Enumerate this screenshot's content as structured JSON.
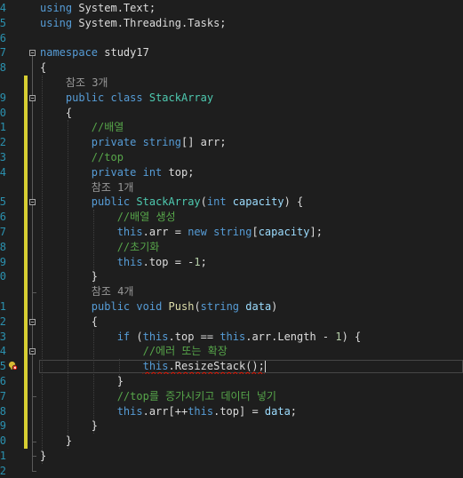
{
  "editor": {
    "language": "C#",
    "colors": {
      "background": "#1e1e1e",
      "line_number": "#2b91af",
      "keyword": "#569cd6",
      "type": "#4ec9b0",
      "comment": "#57a64a",
      "method": "#dcdcaa",
      "parameter": "#9cdcfe",
      "number": "#b5cea8",
      "codelens": "#999999",
      "saved_change": "#d7ce32",
      "error": "#e51400"
    },
    "lines": [
      {
        "num": "4",
        "change": "",
        "tokens": [
          {
            "t": "using",
            "c": "kw"
          },
          {
            "t": " System.Text;",
            "c": "pl"
          }
        ]
      },
      {
        "num": "5",
        "change": "",
        "tokens": [
          {
            "t": "using",
            "c": "kw"
          },
          {
            "t": " System.Threading.Tasks;",
            "c": "pl"
          }
        ]
      },
      {
        "num": "6",
        "change": "",
        "tokens": []
      },
      {
        "num": "7",
        "change": "",
        "tokens": [
          {
            "t": "namespace",
            "c": "kw"
          },
          {
            "t": " study17",
            "c": "pl"
          }
        ]
      },
      {
        "num": "8",
        "change": "",
        "tokens": [
          {
            "t": "{",
            "c": "pl"
          }
        ]
      },
      {
        "num": "",
        "change": "saved",
        "tokens": [
          {
            "t": "    참조 3개",
            "c": "lens"
          }
        ]
      },
      {
        "num": "9",
        "change": "saved",
        "tokens": [
          {
            "t": "    ",
            "c": "pl"
          },
          {
            "t": "public",
            "c": "kw"
          },
          {
            "t": " ",
            "c": "pl"
          },
          {
            "t": "class",
            "c": "kw"
          },
          {
            "t": " ",
            "c": "pl"
          },
          {
            "t": "StackArray",
            "c": "ty"
          }
        ]
      },
      {
        "num": "0",
        "change": "saved",
        "tokens": [
          {
            "t": "    {",
            "c": "pl"
          }
        ]
      },
      {
        "num": "1",
        "change": "saved",
        "tokens": [
          {
            "t": "        ",
            "c": "pl"
          },
          {
            "t": "//배열",
            "c": "cm"
          }
        ]
      },
      {
        "num": "2",
        "change": "saved",
        "tokens": [
          {
            "t": "        ",
            "c": "pl"
          },
          {
            "t": "private",
            "c": "kw"
          },
          {
            "t": " ",
            "c": "pl"
          },
          {
            "t": "string",
            "c": "kw"
          },
          {
            "t": "[] arr;",
            "c": "pl"
          }
        ]
      },
      {
        "num": "3",
        "change": "saved",
        "tokens": [
          {
            "t": "        ",
            "c": "pl"
          },
          {
            "t": "//top",
            "c": "cm"
          }
        ]
      },
      {
        "num": "4",
        "change": "saved",
        "tokens": [
          {
            "t": "        ",
            "c": "pl"
          },
          {
            "t": "private",
            "c": "kw"
          },
          {
            "t": " ",
            "c": "pl"
          },
          {
            "t": "int",
            "c": "kw"
          },
          {
            "t": " top;",
            "c": "pl"
          }
        ]
      },
      {
        "num": "",
        "change": "saved",
        "tokens": [
          {
            "t": "        참조 1개",
            "c": "lens"
          }
        ]
      },
      {
        "num": "5",
        "change": "saved",
        "tokens": [
          {
            "t": "        ",
            "c": "pl"
          },
          {
            "t": "public",
            "c": "kw"
          },
          {
            "t": " ",
            "c": "pl"
          },
          {
            "t": "StackArray",
            "c": "ty"
          },
          {
            "t": "(",
            "c": "pl"
          },
          {
            "t": "int",
            "c": "kw"
          },
          {
            "t": " ",
            "c": "pl"
          },
          {
            "t": "capacity",
            "c": "pm"
          },
          {
            "t": ") {",
            "c": "pl"
          }
        ]
      },
      {
        "num": "6",
        "change": "saved",
        "tokens": [
          {
            "t": "            ",
            "c": "pl"
          },
          {
            "t": "//배열 생성",
            "c": "cm"
          }
        ]
      },
      {
        "num": "7",
        "change": "saved",
        "tokens": [
          {
            "t": "            ",
            "c": "pl"
          },
          {
            "t": "this",
            "c": "kw"
          },
          {
            "t": ".arr = ",
            "c": "pl"
          },
          {
            "t": "new",
            "c": "kw"
          },
          {
            "t": " ",
            "c": "pl"
          },
          {
            "t": "string",
            "c": "kw"
          },
          {
            "t": "[",
            "c": "pl"
          },
          {
            "t": "capacity",
            "c": "pm"
          },
          {
            "t": "];",
            "c": "pl"
          }
        ]
      },
      {
        "num": "8",
        "change": "saved",
        "tokens": [
          {
            "t": "            ",
            "c": "pl"
          },
          {
            "t": "//초기화",
            "c": "cm"
          }
        ]
      },
      {
        "num": "9",
        "change": "saved",
        "tokens": [
          {
            "t": "            ",
            "c": "pl"
          },
          {
            "t": "this",
            "c": "kw"
          },
          {
            "t": ".top = -",
            "c": "pl"
          },
          {
            "t": "1",
            "c": "nm"
          },
          {
            "t": ";",
            "c": "pl"
          }
        ]
      },
      {
        "num": "0",
        "change": "saved",
        "tokens": [
          {
            "t": "        }",
            "c": "pl"
          }
        ]
      },
      {
        "num": "",
        "change": "saved",
        "tokens": [
          {
            "t": "        참조 4개",
            "c": "lens"
          }
        ]
      },
      {
        "num": "1",
        "change": "saved",
        "tokens": [
          {
            "t": "        ",
            "c": "pl"
          },
          {
            "t": "public",
            "c": "kw"
          },
          {
            "t": " ",
            "c": "pl"
          },
          {
            "t": "void",
            "c": "kw"
          },
          {
            "t": " ",
            "c": "pl"
          },
          {
            "t": "Push",
            "c": "fn"
          },
          {
            "t": "(",
            "c": "pl"
          },
          {
            "t": "string",
            "c": "kw"
          },
          {
            "t": " ",
            "c": "pl"
          },
          {
            "t": "data",
            "c": "pm"
          },
          {
            "t": ")",
            "c": "pl"
          }
        ]
      },
      {
        "num": "2",
        "change": "saved",
        "tokens": [
          {
            "t": "        {",
            "c": "pl"
          }
        ]
      },
      {
        "num": "3",
        "change": "saved",
        "tokens": [
          {
            "t": "            ",
            "c": "pl"
          },
          {
            "t": "if",
            "c": "kw"
          },
          {
            "t": " (",
            "c": "pl"
          },
          {
            "t": "this",
            "c": "kw"
          },
          {
            "t": ".top == ",
            "c": "pl"
          },
          {
            "t": "this",
            "c": "kw"
          },
          {
            "t": ".arr.Length - ",
            "c": "pl"
          },
          {
            "t": "1",
            "c": "nm"
          },
          {
            "t": ") {",
            "c": "pl"
          }
        ]
      },
      {
        "num": "4",
        "change": "saved",
        "tokens": [
          {
            "t": "                ",
            "c": "pl"
          },
          {
            "t": "//에러 또는 확장",
            "c": "cm"
          }
        ]
      },
      {
        "num": "5",
        "change": "saved",
        "current": true,
        "error": true,
        "tokens": [
          {
            "t": "                ",
            "c": "pl"
          },
          {
            "t": "this",
            "c": "kw",
            "sq": true
          },
          {
            "t": ".ResizeStack();",
            "c": "pl",
            "sq": true
          }
        ]
      },
      {
        "num": "6",
        "change": "saved",
        "tokens": [
          {
            "t": "            }",
            "c": "pl"
          }
        ]
      },
      {
        "num": "7",
        "change": "saved",
        "tokens": [
          {
            "t": "            ",
            "c": "pl"
          },
          {
            "t": "//top를 증가시키고 데이터 넣기",
            "c": "cm"
          }
        ]
      },
      {
        "num": "8",
        "change": "saved",
        "tokens": [
          {
            "t": "            ",
            "c": "pl"
          },
          {
            "t": "this",
            "c": "kw"
          },
          {
            "t": ".arr[++",
            "c": "pl"
          },
          {
            "t": "this",
            "c": "kw"
          },
          {
            "t": ".top] = ",
            "c": "pl"
          },
          {
            "t": "data",
            "c": "pm"
          },
          {
            "t": ";",
            "c": "pl"
          }
        ]
      },
      {
        "num": "9",
        "change": "saved",
        "tokens": [
          {
            "t": "        }",
            "c": "pl"
          }
        ]
      },
      {
        "num": "0",
        "change": "saved",
        "tokens": [
          {
            "t": "    }",
            "c": "pl"
          }
        ]
      },
      {
        "num": "1",
        "change": "",
        "tokens": [
          {
            "t": "}",
            "c": "pl"
          }
        ]
      },
      {
        "num": "2",
        "change": "",
        "tokens": []
      }
    ]
  }
}
